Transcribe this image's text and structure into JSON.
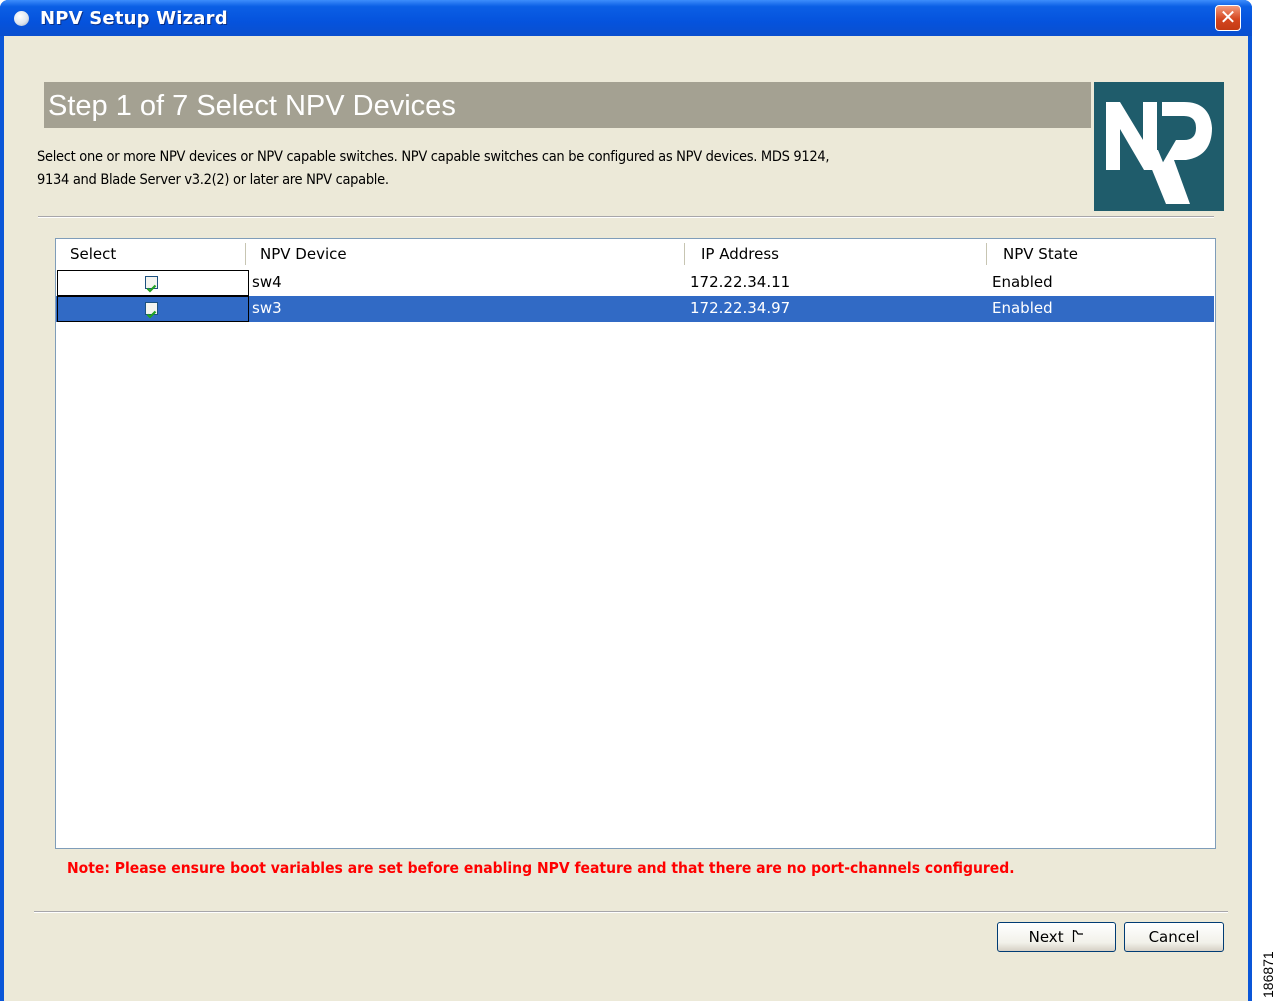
{
  "window": {
    "title": "NPV Setup Wizard",
    "close_glyph": "✕"
  },
  "header": {
    "step_title": "Step 1 of 7 Select NPV Devices",
    "description_line1": "Select one or more NPV devices or NPV capable switches.  NPV capable switches can be configured as NPV devices.  MDS 9124,",
    "description_line2": "9134 and Blade Server v3.2(2) or later are NPV capable.",
    "logo_text": "NPV"
  },
  "table": {
    "columns": [
      "Select",
      "NPV Device",
      "IP Address",
      "NPV State"
    ],
    "rows": [
      {
        "selected": true,
        "device": "sw4",
        "ip": "172.22.34.11",
        "state": "Enabled",
        "highlighted": false
      },
      {
        "selected": true,
        "device": "sw3",
        "ip": "172.22.34.97",
        "state": "Enabled",
        "highlighted": true
      }
    ]
  },
  "note": "Note: Please ensure boot variables are set before enabling NPV feature and that there are no port-channels configured.",
  "buttons": {
    "next": "Next",
    "cancel": "Cancel"
  },
  "watermark": "186871",
  "colors": {
    "note": "#ff0000",
    "selection": "#316ac5",
    "header_band": "#a4a192",
    "logo_bg": "#1f5c6b"
  }
}
